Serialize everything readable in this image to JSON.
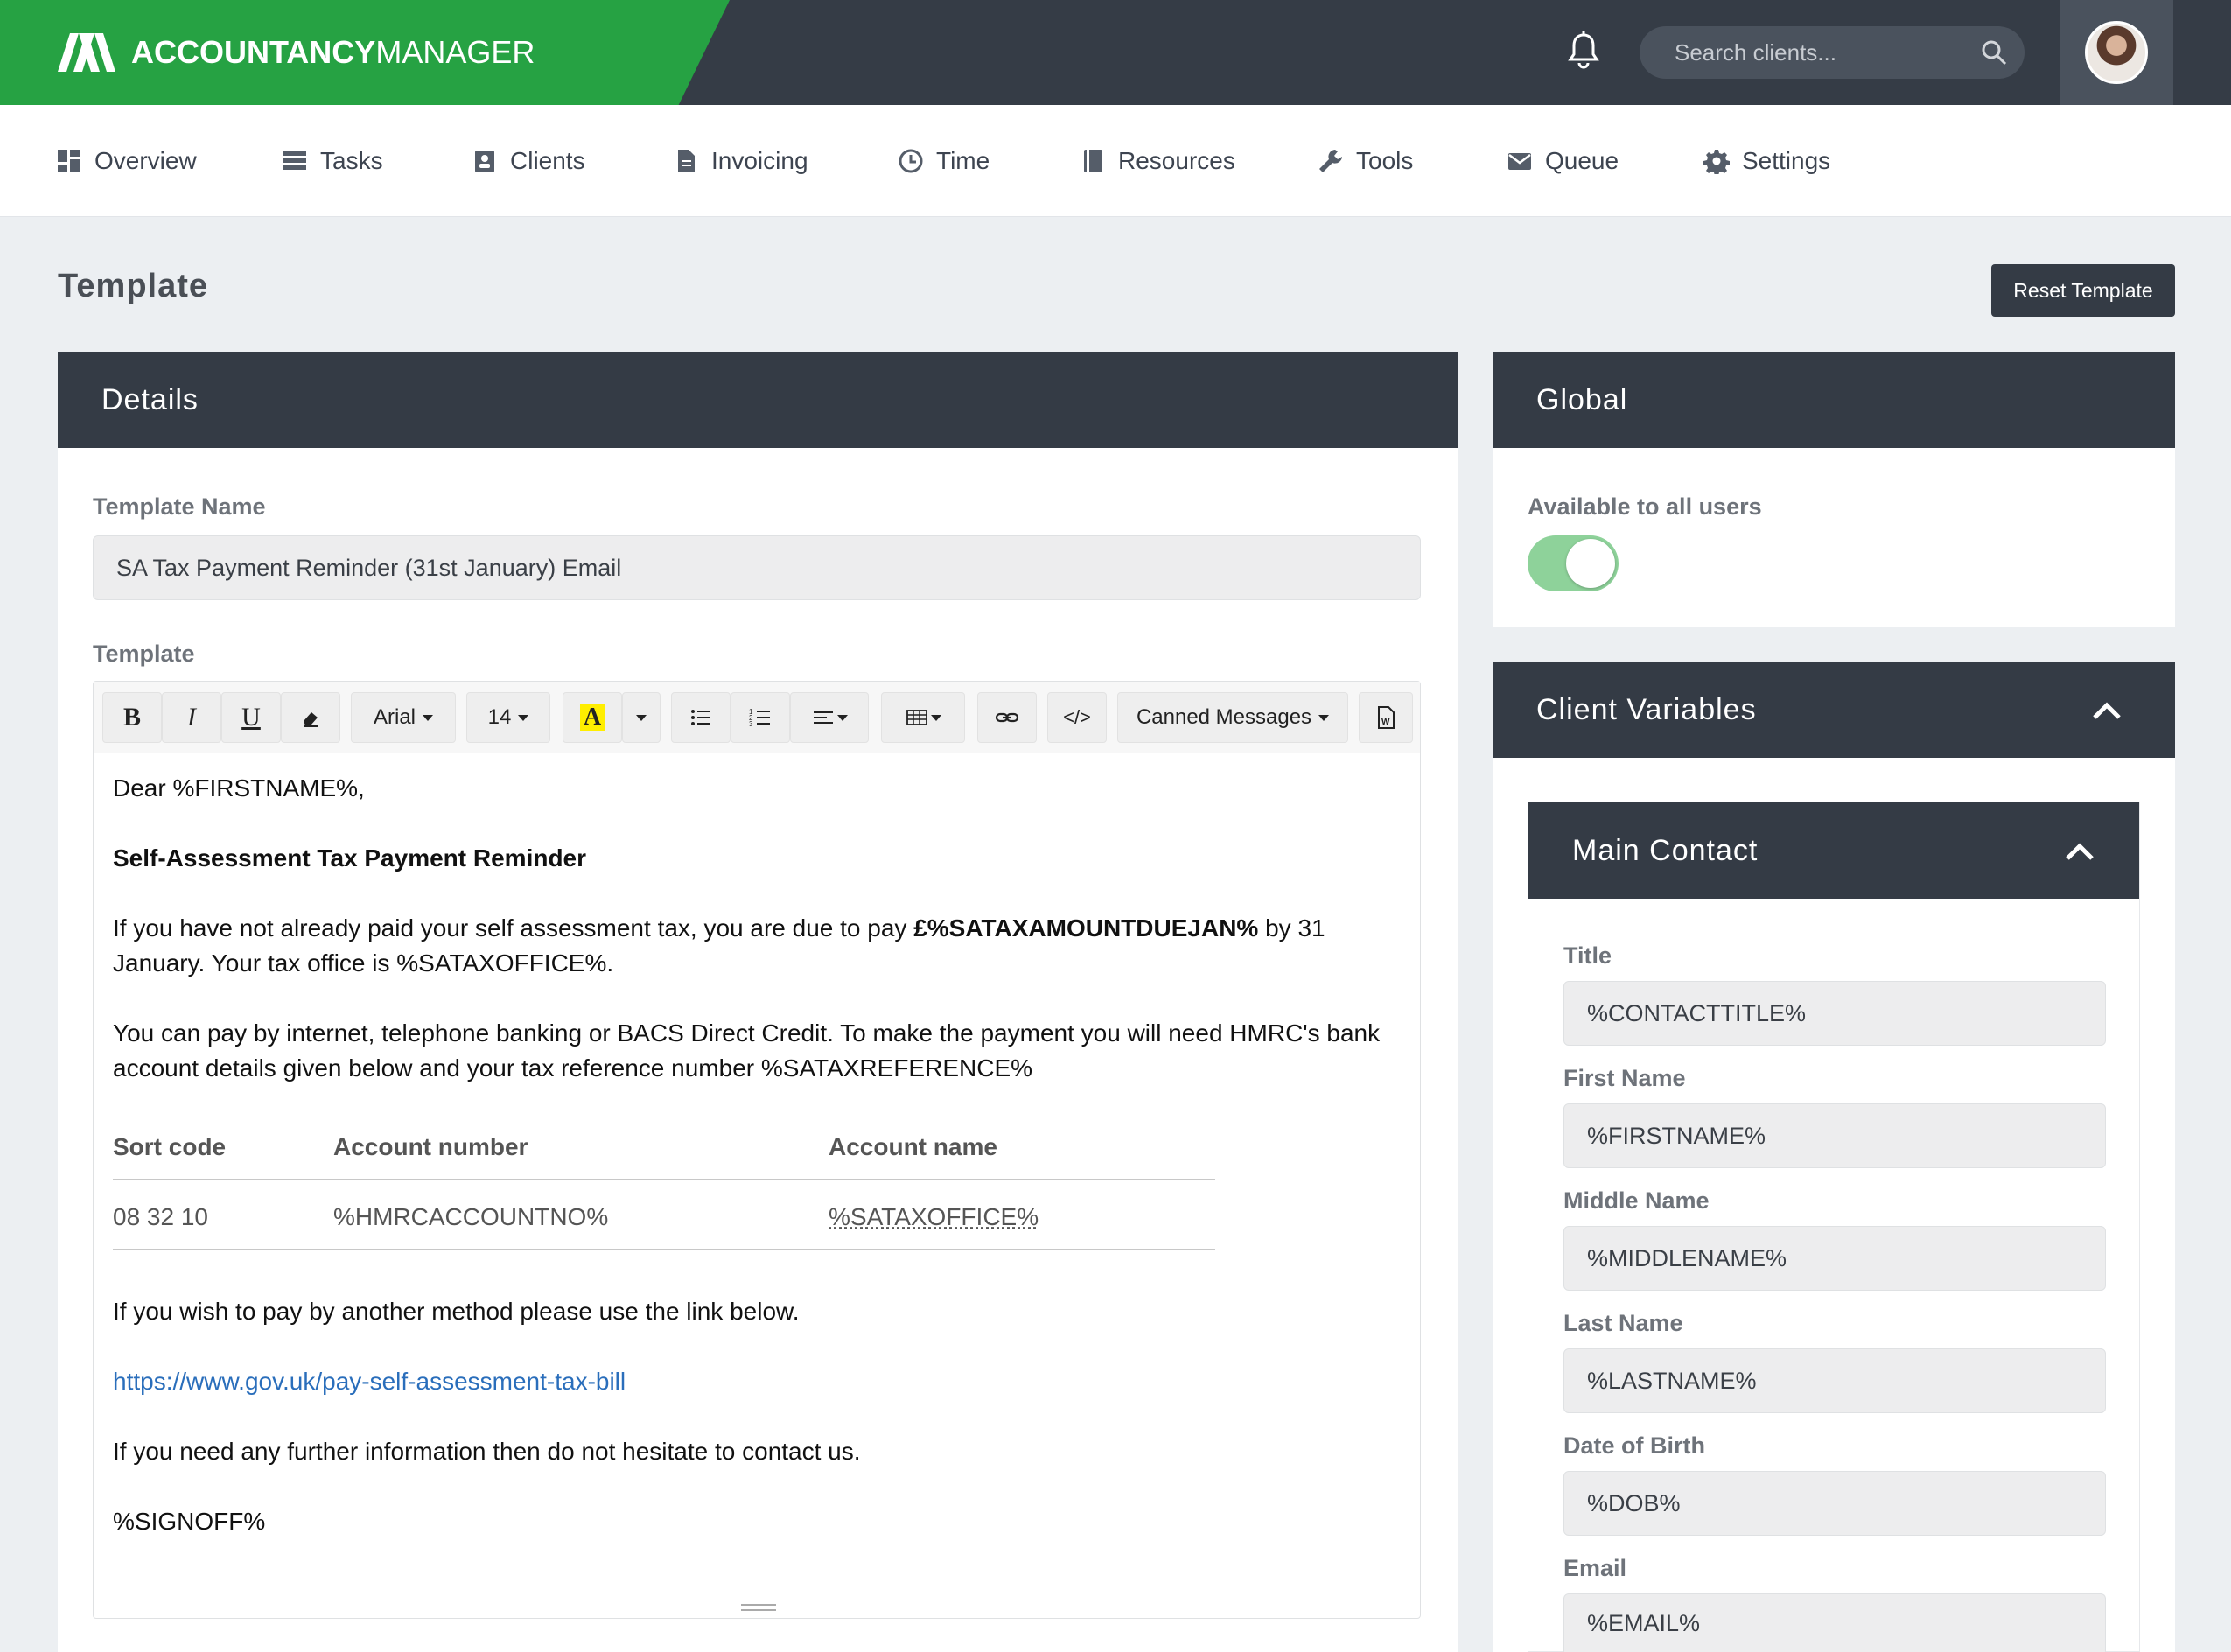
{
  "brand": {
    "name_bold": "ACCOUNTANCY",
    "name_light": "MANAGER",
    "color": "#26a243"
  },
  "search": {
    "placeholder": "Search clients..."
  },
  "nav": {
    "items": [
      {
        "label": "Overview",
        "icon": "dashboard-icon"
      },
      {
        "label": "Tasks",
        "icon": "tasks-icon"
      },
      {
        "label": "Clients",
        "icon": "clients-icon"
      },
      {
        "label": "Invoicing",
        "icon": "document-icon"
      },
      {
        "label": "Time",
        "icon": "clock-icon"
      },
      {
        "label": "Resources",
        "icon": "book-icon"
      },
      {
        "label": "Tools",
        "icon": "wrench-icon"
      },
      {
        "label": "Queue",
        "icon": "envelope-icon"
      },
      {
        "label": "Settings",
        "icon": "gear-icon"
      }
    ]
  },
  "page": {
    "title": "Template",
    "reset_label": "Reset Template"
  },
  "details": {
    "title": "Details",
    "template_name_label": "Template Name",
    "template_name_value": "SA Tax Payment Reminder (31st January) Email",
    "template_label": "Template",
    "toolbar": {
      "font": "Arial",
      "size": "14",
      "canned": "Canned Messages",
      "code": "</>"
    },
    "content": {
      "greeting": "Dear %FIRSTNAME%,",
      "heading": "Self-Assessment Tax Payment Reminder",
      "p1_a": "If you have not already paid your self assessment tax, you are due to pay ",
      "p1_b": "£%SATAXAMOUNTDUEJAN%",
      "p1_c": " by 31 January. Your tax office is %SATAXOFFICE%.",
      "p2": "You can pay by internet, telephone banking or BACS Direct Credit. To make the payment you will need HMRC's bank account details given below and your tax reference number %SATAXREFERENCE%",
      "table": {
        "headers": [
          "Sort code",
          "Account number",
          "Account name"
        ],
        "row": [
          "08 32 10",
          "%HMRCACCOUNTNO%",
          "%SATAXOFFICE%"
        ]
      },
      "p3": "If you wish to pay by another method please use the link below.",
      "link": "https://www.gov.uk/pay-self-assessment-tax-bill",
      "p4": "If you need any further information then do not hesitate to contact us.",
      "signoff": "%SIGNOFF%"
    }
  },
  "global": {
    "title": "Global",
    "available_label": "Available to all users",
    "available": true
  },
  "client_vars": {
    "title": "Client Variables",
    "main_contact": {
      "title": "Main Contact",
      "fields": [
        {
          "label": "Title",
          "value": "%CONTACTTITLE%"
        },
        {
          "label": "First Name",
          "value": "%FIRSTNAME%"
        },
        {
          "label": "Middle Name",
          "value": "%MIDDLENAME%"
        },
        {
          "label": "Last Name",
          "value": "%LASTNAME%"
        },
        {
          "label": "Date of Birth",
          "value": "%DOB%"
        },
        {
          "label": "Email",
          "value": "%EMAIL%"
        }
      ]
    }
  }
}
